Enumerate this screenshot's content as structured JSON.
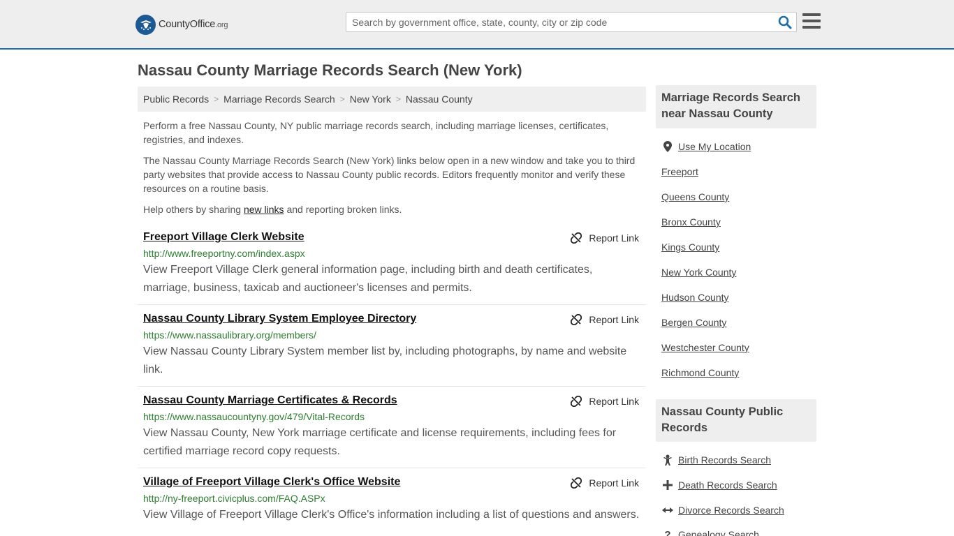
{
  "header": {
    "logo_brand": "CountyOffice",
    "logo_tld": ".org",
    "search_placeholder": "Search by government office, state, county, city or zip code"
  },
  "page": {
    "title": "Nassau County Marriage Records Search (New York)"
  },
  "breadcrumb": [
    "Public Records",
    "Marriage Records Search",
    "New York",
    "Nassau County"
  ],
  "intro": {
    "p1": "Perform a free Nassau County, NY public marriage records search, including marriage licenses, certificates, registries, and indexes.",
    "p2": "The Nassau County Marriage Records Search (New York) links below open in a new window and take you to third party websites that provide access to Nassau County public records. Editors frequently monitor and verify these resources on a routine basis.",
    "p3_before": "Help others by sharing ",
    "p3_link": "new links",
    "p3_after": " and reporting broken links."
  },
  "report_label": "Report Link",
  "results": [
    {
      "title": "Freeport Village Clerk Website",
      "url": "http://www.freeportny.com/index.aspx",
      "desc": "View Freeport Village Clerk general information page, including birth and death certificates, marriage, business, taxicab and auctioneer's licenses and permits."
    },
    {
      "title": "Nassau County Library System Employee Directory",
      "url": "https://www.nassaulibrary.org/members/",
      "desc": "View Nassau County Library System member list by, including photographs, by name and website link."
    },
    {
      "title": "Nassau County Marriage Certificates & Records",
      "url": "https://www.nassaucountyny.gov/479/Vital-Records",
      "desc": "View Nassau County, New York marriage certificate and license requirements, including fees for certified marriage record copy requests."
    },
    {
      "title": "Village of Freeport Village Clerk's Office Website",
      "url": "http://ny-freeport.civicplus.com/FAQ.ASPx",
      "desc": "View Village of Freeport Village Clerk's Office's information including a list of questions and answers."
    }
  ],
  "sidebar": {
    "nearby_heading": "Marriage Records Search near Nassau County",
    "use_location": "Use My Location",
    "nearby": [
      "Freeport",
      "Queens County",
      "Bronx County",
      "Kings County",
      "New York County",
      "Hudson County",
      "Bergen County",
      "Westchester County",
      "Richmond County"
    ],
    "public_heading": "Nassau County Public Records",
    "public_links": [
      {
        "label": "Birth Records Search",
        "icon": "baby-icon"
      },
      {
        "label": "Death Records Search",
        "icon": "cross-icon"
      },
      {
        "label": "Divorce Records Search",
        "icon": "arrows-horizontal-icon"
      },
      {
        "label": "Genealogy Search",
        "icon": "question-icon"
      }
    ]
  }
}
